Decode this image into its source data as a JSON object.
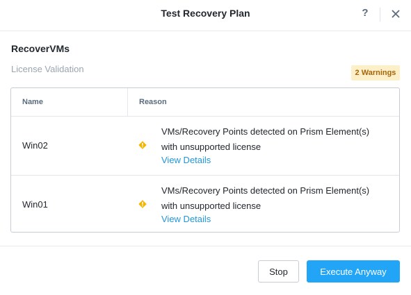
{
  "dialog": {
    "title": "Test Recovery Plan",
    "help_label": "?",
    "close_icon": "close-icon"
  },
  "plan": {
    "name": "RecoverVMs"
  },
  "validation": {
    "section_label": "License Validation",
    "warnings_badge": "2 Warnings"
  },
  "table": {
    "columns": [
      "Name",
      "Reason"
    ],
    "rows": [
      {
        "name": "Win02",
        "status_icon": "warning-icon",
        "reason_line1": "VMs/Recovery Points detected on Prism Element(s)",
        "reason_line2": "with unsupported license",
        "link": "View Details"
      },
      {
        "name": "Win01",
        "status_icon": "warning-icon",
        "reason_line1": "VMs/Recovery Points detected on Prism Element(s)",
        "reason_line2": "with unsupported license",
        "link": "View Details"
      }
    ]
  },
  "footer": {
    "stop_label": "Stop",
    "execute_label": "Execute Anyway"
  },
  "colors": {
    "primary": "#22a5f7",
    "link": "#2196d9",
    "warning_icon": "#f5b400",
    "warning_badge_bg": "#fdf0c9",
    "warning_badge_text": "#a4660b"
  }
}
